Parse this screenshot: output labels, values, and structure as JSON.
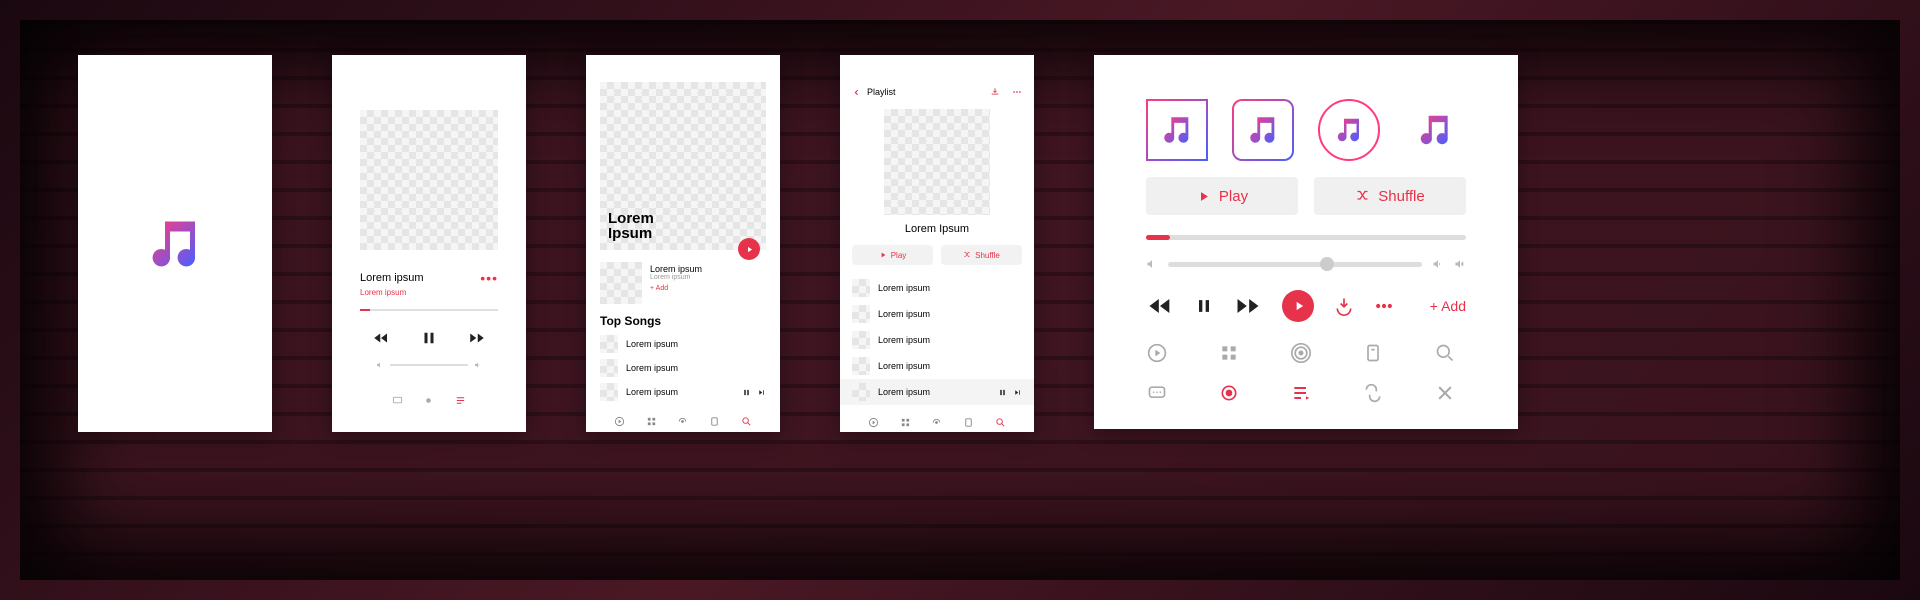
{
  "player": {
    "title": "Lorem ipsum",
    "subtitle": "Lorem ipsum"
  },
  "artist": {
    "name": "Lorem\nIpsum",
    "featured_title": "Lorem ipsum",
    "featured_sub": "Lorem ipsum",
    "add": "+ Add",
    "top_heading": "Top Songs",
    "songs": [
      "Lorem ipsum",
      "Lorem ipsum",
      "Lorem ipsum"
    ]
  },
  "playlist": {
    "back": "Playlist",
    "album": "Lorem Ipsum",
    "play": "Play",
    "shuffle": "Shuffle",
    "tracks": [
      "Lorem ipsum",
      "Lorem ipsum",
      "Lorem ipsum",
      "Lorem ipsum",
      "Lorem ipsum"
    ]
  },
  "panel": {
    "play": "Play",
    "shuffle": "Shuffle",
    "add": "+ Add"
  }
}
